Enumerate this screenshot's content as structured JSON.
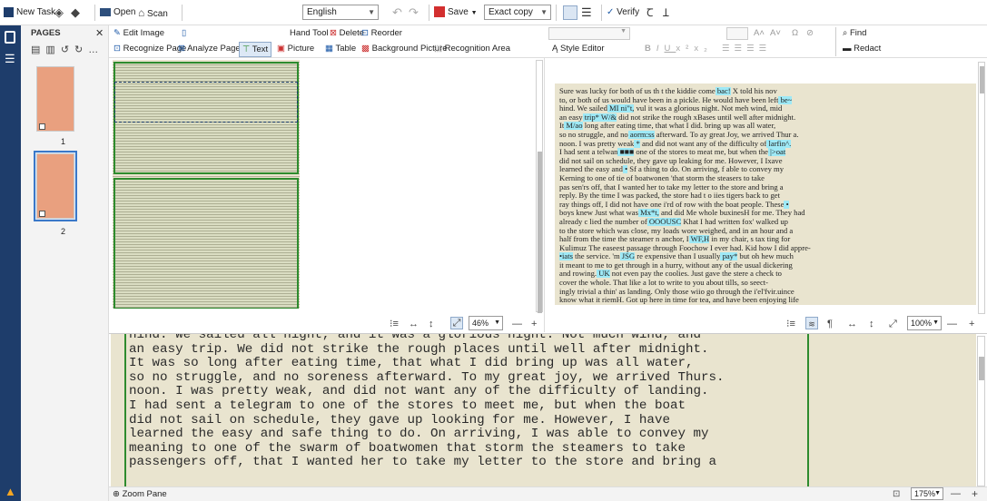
{
  "toolbar": {
    "new_task": "New Task",
    "open": "Open",
    "scan": "Scan",
    "language": "English",
    "save": "Save",
    "save_mode": "Exact copy",
    "verify": "Verify"
  },
  "pages_panel": {
    "title": "PAGES",
    "pages": [
      {
        "number": "1"
      },
      {
        "number": "2"
      }
    ]
  },
  "toolbar2": {
    "edit_image": "Edit Image",
    "recognize_page": "Recognize Page",
    "analyze_page": "Analyze Page",
    "hand_tool": "Hand Tool",
    "delete": "Delete",
    "reorder": "Reorder",
    "text": "Text",
    "picture": "Picture",
    "table": "Table",
    "background_picture": "Background Picture",
    "recognition_area": "Recognition Area",
    "style_editor": "Style Editor",
    "find": "Find",
    "redact": "Redact"
  },
  "image_zoom": "46%",
  "text_zoom": "100%",
  "zoom_pane_zoom": "175%",
  "zoom_pane_label": "Zoom Pane",
  "recognized_text": [
    "Sure was lucky for both of us th t the kiddie come bac! X told his nov",
    "to, or both of us would have been in a pickle. He would have been left be~",
    "hind. We sailed MI ni\"t, vul it was a glorious night. Not meh wind, mid",
    "an easy trip* W/& did not strike the rough xBases until well after midnight.",
    "It M/ao long after eating time, that what I did. bring up was all water,",
    "so no struggle, and no aorm:ss afterward. To ay great Joy, we arrived Thur a.",
    "noon. I was pretty weak * and did not want any of the difficulty of larfin^.",
    "I had sent a telwan ■■■ one of the stores to meat me, but when the |>oat",
    "did not sail on schedule, they gave up leaking for me. However, I Ixave",
    "learned the easy and • Sf a thing to do. On arriving, f able to convey my",
    "Kerning to one of tie of boatwonen 'that storm the steasers to take",
    "pas sen'rs off, that I wanted her to take my letter to the store and bring a",
    "reply. By the time I was packed, the store had t o iies tigers back to get",
    "ray things off, I did not have one i'rd of row with the boat people. These •",
    "boys knew Just what was Mx*t, and did Me whole buxinesH for me. They had",
    "already c lied the number of OOOUSC Khat I had written fox' walked up",
    "to the store which was close, my loads wore weighed, and in an hour and a",
    "half from the time the steamer n anchor, I WF,H in my chair, s tax ting for",
    "Kulimuz The easeest passage through Foochow I ever had. Kid how I did appre-",
    "•iats the service. 'm JSG re expensive than I usually pay* but oh hew much",
    "it meant to me to get through in a hurry, without any of the usual dickering",
    "and rowing. UK not even pay the coolies. Just gave the stere a check to",
    "cover the whole. That like a lot to write to you about tills, so seect-",
    "ingly trivial a thin' as landing. Only those wiio go through the i'el'fvir.uince",
    "know what it riemH. Got up here in time for tea, and have been enjoying life",
    "hugely ever since."
  ],
  "zoom_lines": [
    "hind. We sailed all night, and it was a glorious night. Not much wind, and",
    "an easy trip. We did not strike the rough places until well after midnight.",
    "It was so long after eating time, that what I did bring up was all water,",
    "so no struggle, and no soreness afterward. To my great joy, we arrived Thurs.",
    "noon. I was pretty weak, and did not want any of the difficulty of landing.",
    "I had sent a telegram to one of the stores to meet me, but when the boat",
    "did not sail on schedule, they gave up looking for me. However, I have",
    "learned the easy and safe thing to do. On arriving, I was able to convey my",
    "meaning to one of the swarm of boatwomen that storm the steamers to take",
    "passengers off, that I wanted her to take my letter to the store and bring a"
  ],
  "colors": {
    "rail": "#1e3d6b",
    "highlight": "#9ee9f6",
    "area_green": "#2e8b2e",
    "paper": "#e9e4cf"
  }
}
